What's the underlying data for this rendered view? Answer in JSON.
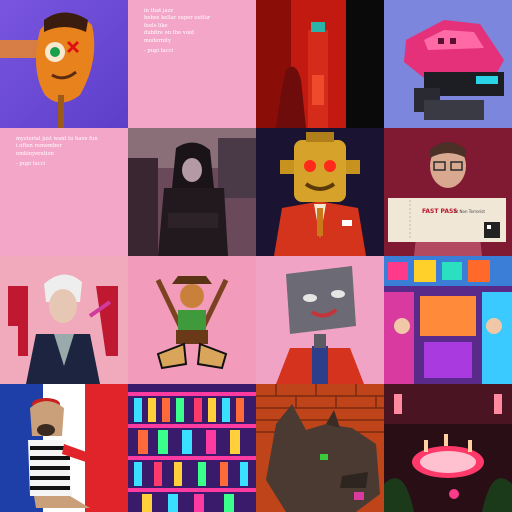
{
  "colors": {
    "poem_bg": "#f4a6c8",
    "poem_text": "#ffffff"
  },
  "tiles": [
    {
      "icon": "surreal-orange-face-portrait"
    },
    {
      "lines": [
        "in that jazz",
        "bebes kellar super outfar",
        "feels like",
        "dubfire on the void",
        "modernity"
      ],
      "signature": "- pupi lucci"
    },
    {
      "icon": "red-drink-abstract"
    },
    {
      "icon": "pixel-pink-shark-goggles"
    },
    {
      "lines": [
        "mysterial just want to have fun",
        "i often remember",
        "emkinyeration"
      ],
      "signature": "- pupi lucci"
    },
    {
      "icon": "hooded-figure-street-photo"
    },
    {
      "icon": "gold-robot-red-suit-portrait"
    },
    {
      "icon": "man-glasses-ticket-portrait",
      "ticket": {
        "title": "FAST PASS",
        "subtitle": "At Non Terrorist"
      }
    },
    {
      "icon": "white-hair-man-graffiti"
    },
    {
      "icon": "cowboy-with-rifles-cartoon"
    },
    {
      "icon": "grey-square-head-red-vest"
    },
    {
      "icon": "psychedelic-market-crowd"
    },
    {
      "icon": "french-bulldog-beret"
    },
    {
      "icon": "neon-shelves-pattern"
    },
    {
      "icon": "pixel-dragon-brick-wall"
    },
    {
      "icon": "neon-pink-ballroom"
    }
  ]
}
